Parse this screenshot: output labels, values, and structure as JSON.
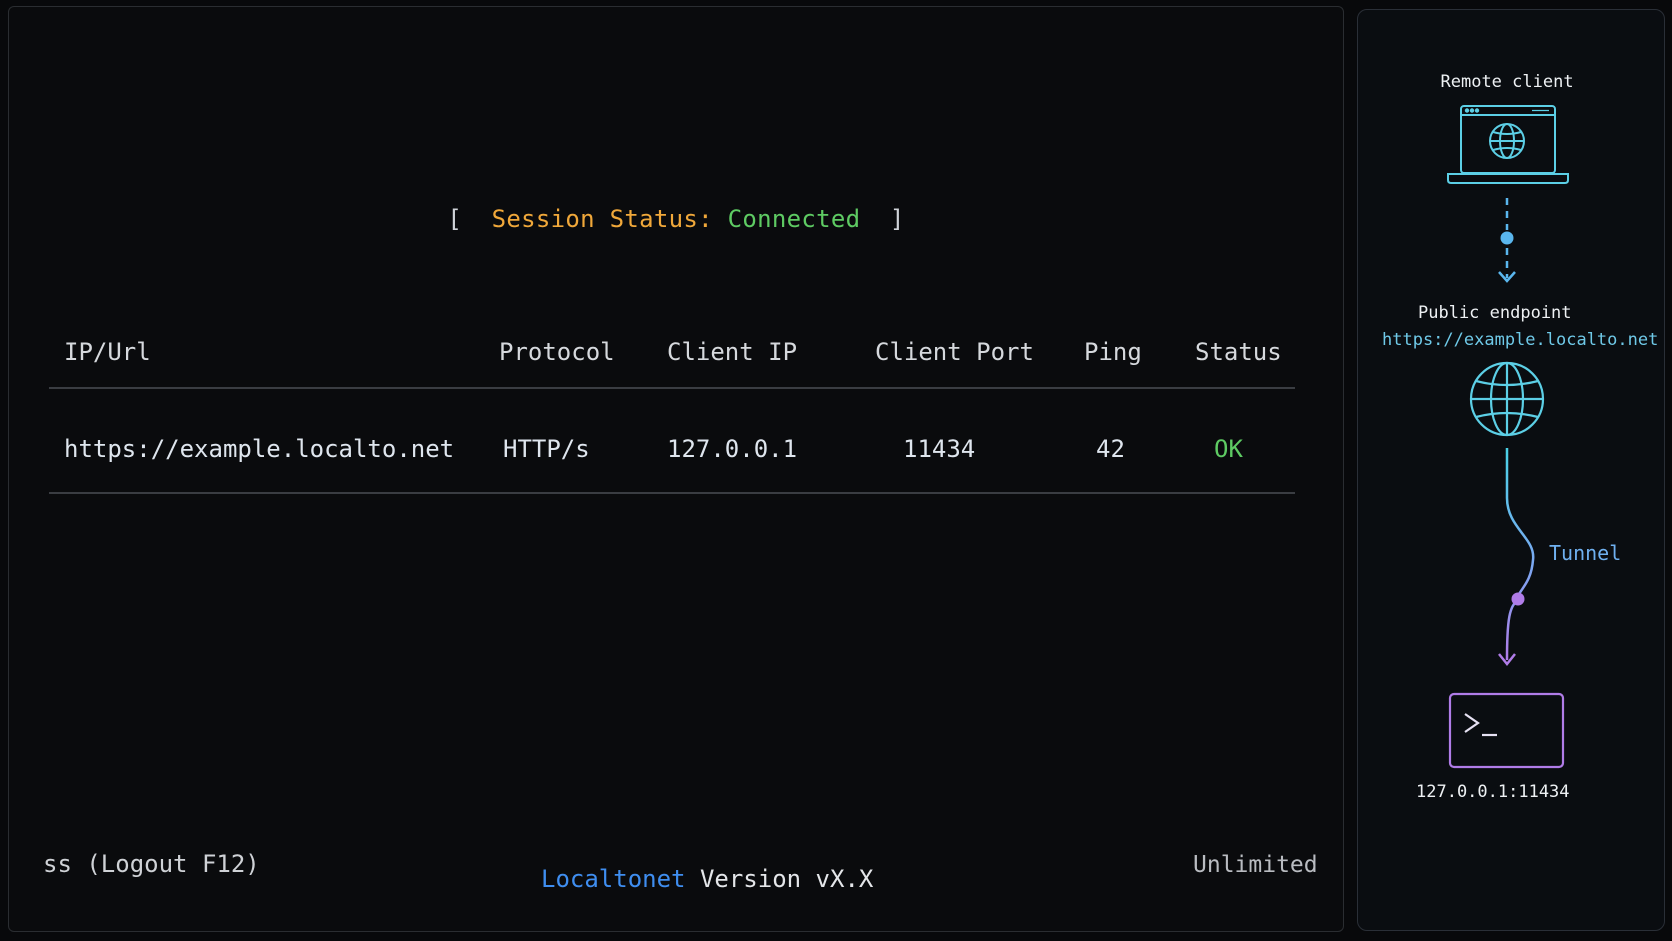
{
  "session": {
    "bracket_open": "[",
    "label": "Session Status:",
    "value": "Connected",
    "bracket_close": "]"
  },
  "table": {
    "headers": [
      "IP/Url",
      "Protocol",
      "Client IP",
      "Client Port",
      "Ping",
      "Status"
    ],
    "rows": [
      [
        "https://example.localto.net",
        "HTTP/s",
        "127.0.0.1",
        "11434",
        "42",
        "OK"
      ]
    ]
  },
  "footer": {
    "logout_text": "ss (Logout F12)",
    "brand": "Localtonet",
    "version": "Version vX.X",
    "plan": "Unlimited"
  },
  "diagram": {
    "remote_label": "Remote client",
    "public_label": "Public endpoint",
    "public_url": "https://example.localto.net",
    "tunnel_label": "Tunnel",
    "local_address": "127.0.0.1:11434",
    "icons": [
      "laptop-globe-icon",
      "globe-icon",
      "terminal-icon"
    ]
  },
  "colors": {
    "accent_orange": "#f0a83a",
    "accent_green": "#5ecb63",
    "accent_blue": "#3f8ef0",
    "cyan": "#5ccfe6",
    "purple": "#b07ce8"
  }
}
